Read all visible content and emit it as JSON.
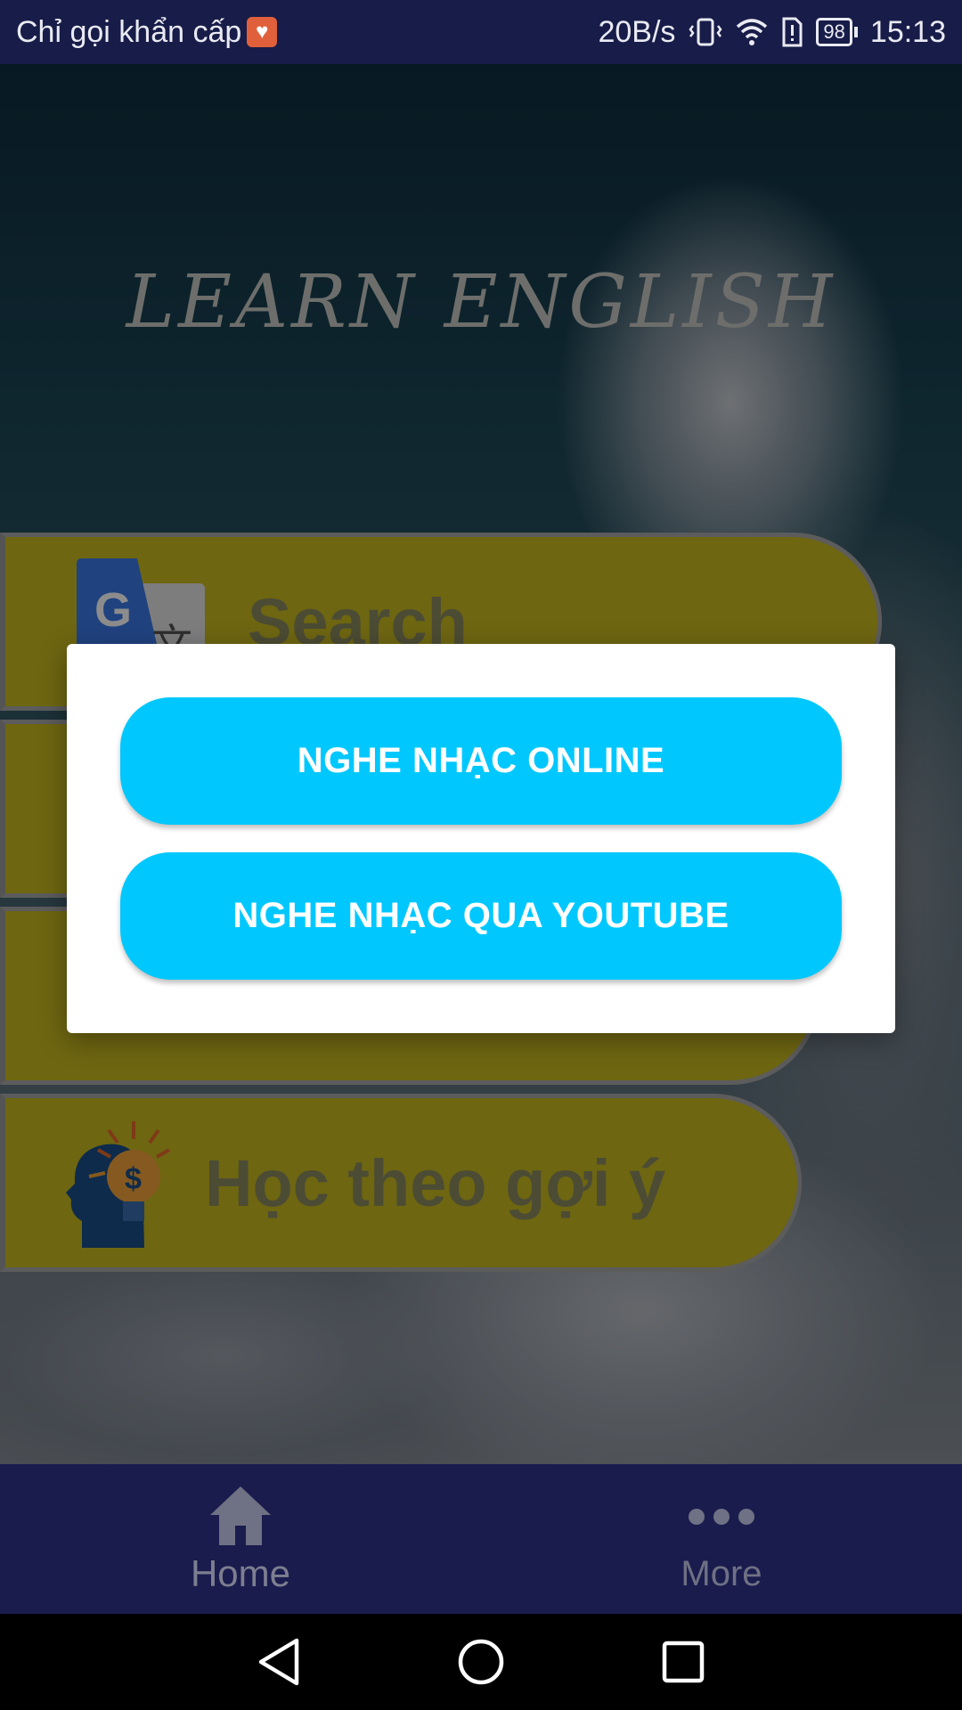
{
  "status_bar": {
    "carrier": "Chỉ gọi khẩn cấp",
    "network_speed": "20B/s",
    "battery": "98",
    "time": "15:13",
    "icons": [
      "sos-icon",
      "vibrate-icon",
      "wifi-icon",
      "sim-alert-icon",
      "battery-icon"
    ]
  },
  "app": {
    "title": "LEARN ENGLISH"
  },
  "menu": {
    "items": [
      {
        "label": "Search",
        "icon": "google-translate-icon"
      },
      {
        "label": "",
        "icon": ""
      },
      {
        "label": "",
        "icon": ""
      },
      {
        "label": "Học theo gợi ý",
        "icon": "idea-head-icon"
      }
    ]
  },
  "dialog": {
    "buttons": [
      {
        "label": "NGHE NHẠC ONLINE"
      },
      {
        "label": "NGHE NHẠC QUA YOUTUBE"
      }
    ],
    "button_color": "#00c8ff"
  },
  "bottom_nav": {
    "items": [
      {
        "label": "Home",
        "icon": "home-icon"
      },
      {
        "label": "More",
        "icon": "more-dots-icon"
      }
    ]
  },
  "system_nav": {
    "icons": [
      "back-icon",
      "home-circle-icon",
      "recents-icon"
    ]
  },
  "colors": {
    "status_bar": "#181c48",
    "bottom_nav": "#1a1c4e",
    "menu_item": "#c9bb20"
  }
}
